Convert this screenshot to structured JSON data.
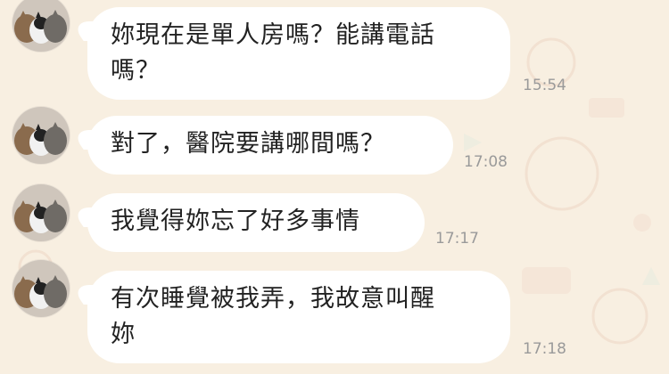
{
  "messages": [
    {
      "text_line1": "妳現在是單人房嗎？能講電話",
      "text_line2": "嗎？",
      "time": "15:54"
    },
    {
      "text_line1": "對了，醫院要講哪間嗎？",
      "text_line2": "",
      "time": "17:08"
    },
    {
      "text_line1": "我覺得妳忘了好多事情",
      "text_line2": "",
      "time": "17:17"
    },
    {
      "text_line1": "有次睡覺被我弄，我故意叫醒",
      "text_line2": "妳",
      "time": "17:18"
    }
  ],
  "colors": {
    "background": "#f8efe1",
    "bubble": "#ffffff",
    "timestamp": "#9a9a9a"
  },
  "icons": {
    "avatar": "cats-avatar-icon"
  }
}
